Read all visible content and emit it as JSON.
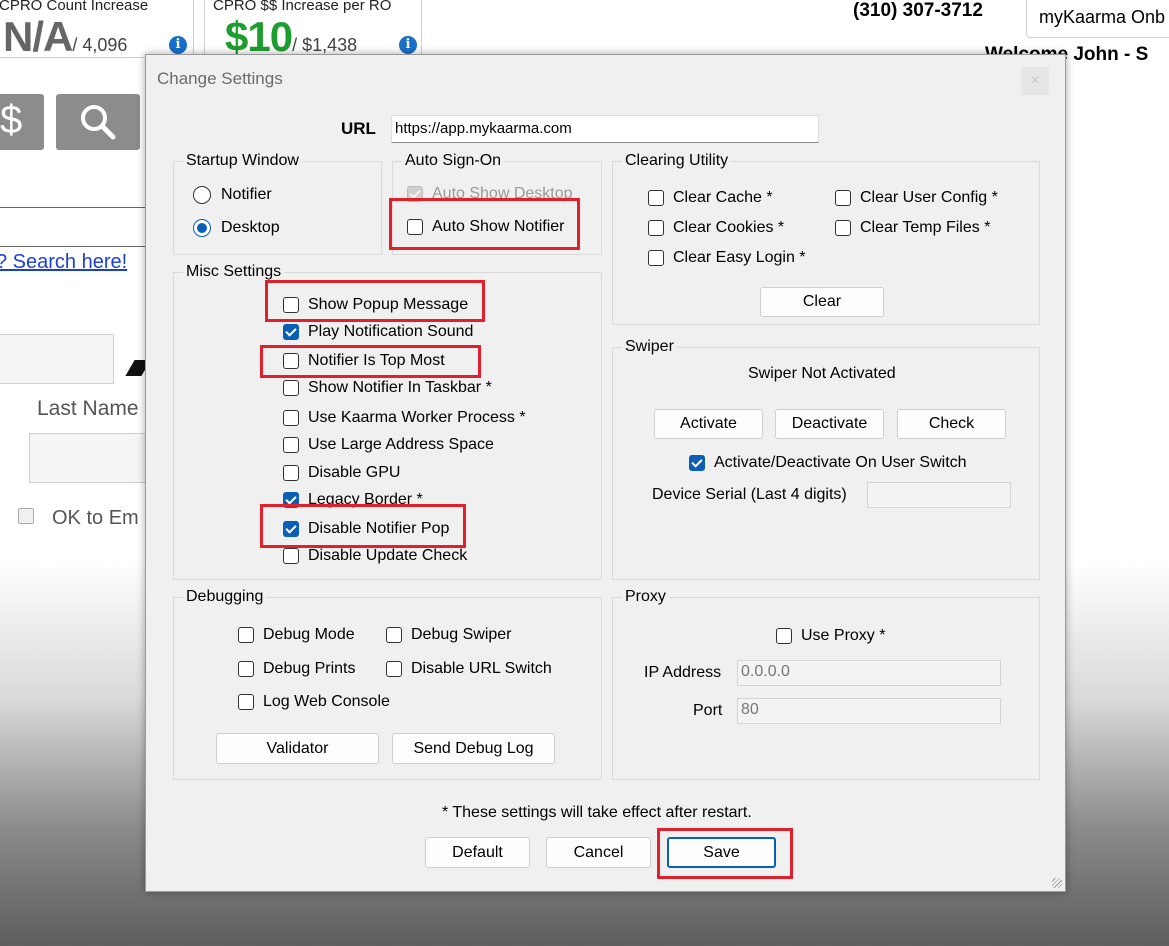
{
  "background": {
    "stat1": {
      "label": "CPRO Count Increase",
      "value": "N/A",
      "total": "/ 4,096",
      "icon": "info-icon"
    },
    "stat2": {
      "label": "CPRO $$ Increase per RO",
      "value": "$10",
      "total": "/ $1,438",
      "icon": "info-icon"
    },
    "phone": "(310) 307-3712",
    "account": "myKaarma Onb",
    "welcome": "Welcome John - S",
    "dollar_button": "$",
    "search_link": "? Search here!",
    "last_name_label": "Last Name",
    "ok_email_label": "OK to Em"
  },
  "dialog": {
    "title": "Change Settings",
    "close_label": "×",
    "url_label": "URL",
    "url_value": "https://app.mykaarma.com",
    "startup": {
      "title": "Startup Window",
      "options": [
        {
          "label": "Notifier",
          "checked": false
        },
        {
          "label": "Desktop",
          "checked": true
        }
      ]
    },
    "auto_sign_on": {
      "title": "Auto Sign-On",
      "items": [
        {
          "label": "Auto Show Desktop",
          "checked": true,
          "disabled": true
        },
        {
          "label": "Auto Show Notifier",
          "checked": false,
          "disabled": false
        }
      ]
    },
    "clearing": {
      "title": "Clearing Utility",
      "items": [
        {
          "label": "Clear Cache *",
          "checked": false
        },
        {
          "label": "Clear User Config *",
          "checked": false
        },
        {
          "label": "Clear Cookies *",
          "checked": false
        },
        {
          "label": "Clear Temp Files *",
          "checked": false
        },
        {
          "label": "Clear Easy Login *",
          "checked": false
        }
      ],
      "clear_button": "Clear"
    },
    "misc": {
      "title": "Misc Settings",
      "items": [
        {
          "label": "Show Popup Message",
          "checked": false
        },
        {
          "label": "Play Notification Sound",
          "checked": true
        },
        {
          "label": "Notifier Is Top Most",
          "checked": false
        },
        {
          "label": "Show Notifier In Taskbar *",
          "checked": false
        },
        {
          "label": "Use Kaarma Worker Process *",
          "checked": false
        },
        {
          "label": "Use Large Address Space",
          "checked": false
        },
        {
          "label": "Disable GPU",
          "checked": false
        },
        {
          "label": "Legacy Border *",
          "checked": true
        },
        {
          "label": "Disable Notifier Pop",
          "checked": true
        },
        {
          "label": "Disable Update Check",
          "checked": false
        }
      ]
    },
    "swiper": {
      "title": "Swiper",
      "status": "Swiper Not Activated",
      "activate": "Activate",
      "deactivate": "Deactivate",
      "check": "Check",
      "user_switch": {
        "label": "Activate/Deactivate On User Switch",
        "checked": true
      },
      "serial_label": "Device Serial (Last 4 digits)",
      "serial_value": ""
    },
    "debugging": {
      "title": "Debugging",
      "items": [
        {
          "label": "Debug Mode",
          "checked": false
        },
        {
          "label": "Debug Swiper",
          "checked": false
        },
        {
          "label": "Debug Prints",
          "checked": false
        },
        {
          "label": "Disable URL Switch",
          "checked": false
        },
        {
          "label": "Log Web Console",
          "checked": false
        }
      ],
      "validator": "Validator",
      "send_log": "Send Debug Log"
    },
    "proxy": {
      "title": "Proxy",
      "use_proxy": {
        "label": "Use Proxy *",
        "checked": false
      },
      "ip_label": "IP Address",
      "ip_value": "0.0.0.0",
      "port_label": "Port",
      "port_value": "80"
    },
    "footnote": "* These settings will take effect after restart.",
    "default_button": "Default",
    "cancel_button": "Cancel",
    "save_button": "Save"
  },
  "colors": {
    "highlight": "#e0202a",
    "accent": "#0a5fb4",
    "green_value": "#1e9e2e"
  }
}
